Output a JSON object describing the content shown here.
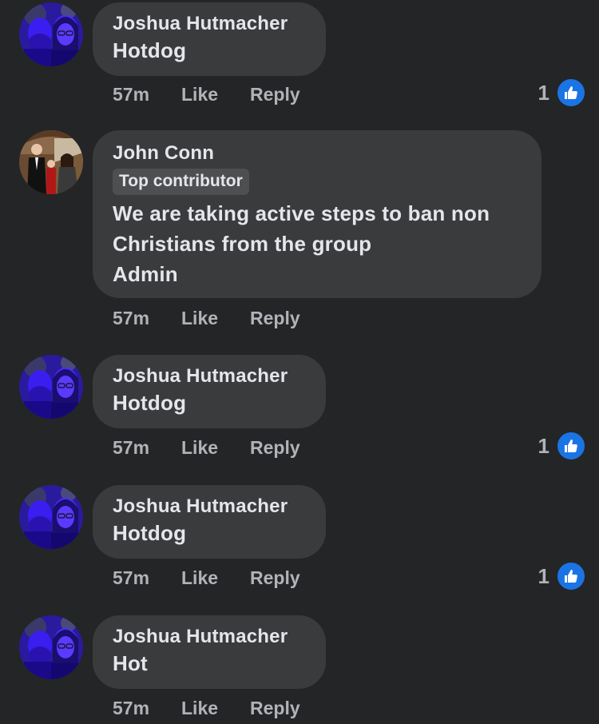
{
  "comments": [
    {
      "author": "Joshua Hutmacher",
      "badge": "",
      "lines": [
        "Hotdog"
      ],
      "time": "57m",
      "like_label": "Like",
      "reply_label": "Reply",
      "reaction_count": "1",
      "avatar": "couple-selfie-blue"
    },
    {
      "author": "John Conn",
      "badge": "Top contributor",
      "lines": [
        "We are taking active steps to ban non",
        "Christians from the group",
        "Admin"
      ],
      "time": "57m",
      "like_label": "Like",
      "reply_label": "Reply",
      "reaction_count": "",
      "avatar": "family-photo"
    },
    {
      "author": "Joshua Hutmacher",
      "badge": "",
      "lines": [
        "Hotdog"
      ],
      "time": "57m",
      "like_label": "Like",
      "reply_label": "Reply",
      "reaction_count": "1",
      "avatar": "couple-selfie-blue"
    },
    {
      "author": "Joshua Hutmacher",
      "badge": "",
      "lines": [
        "Hotdog"
      ],
      "time": "57m",
      "like_label": "Like",
      "reply_label": "Reply",
      "reaction_count": "1",
      "avatar": "couple-selfie-blue"
    },
    {
      "author": "Joshua Hutmacher",
      "badge": "",
      "lines": [
        "Hot"
      ],
      "time": "57m",
      "like_label": "Like",
      "reply_label": "Reply",
      "reaction_count": "",
      "avatar": "couple-selfie-blue"
    }
  ],
  "colors": {
    "background": "#242526",
    "bubble": "#3a3b3c",
    "text": "#e4e6eb",
    "secondary_text": "#b0b3b8",
    "like_blue": "#1b74e4"
  },
  "icons": {
    "reaction": "thumbs-up-icon"
  }
}
